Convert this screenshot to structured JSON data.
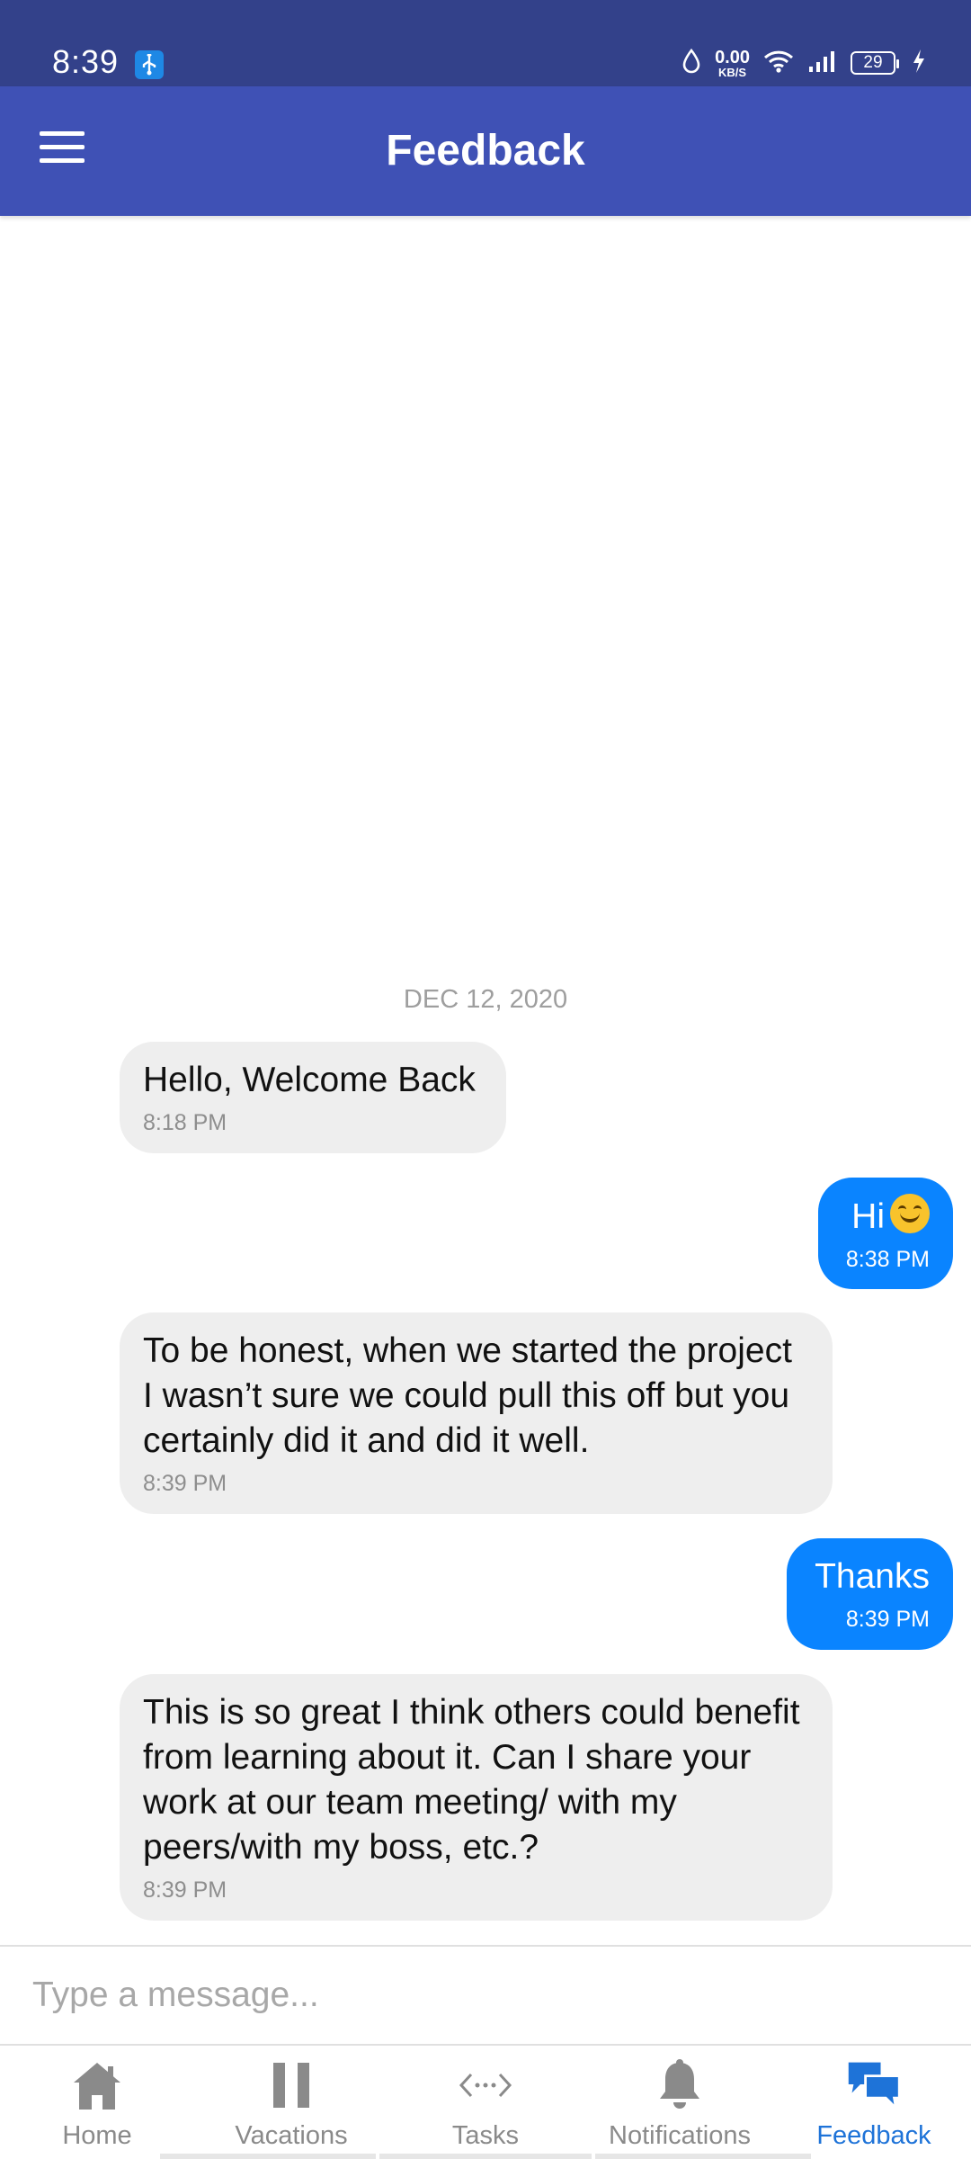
{
  "status_bar": {
    "time": "8:39",
    "net_speed_value": "0.00",
    "net_speed_unit": "KB/S",
    "battery_level": "29"
  },
  "app_bar": {
    "title": "Feedback"
  },
  "chat": {
    "date_separator": "DEC 12, 2020",
    "messages": [
      {
        "direction": "incoming",
        "text": "Hello, Welcome Back",
        "time": "8:18 PM"
      },
      {
        "direction": "outgoing",
        "text": "Hi",
        "emoji": "smiling-face",
        "time": "8:38 PM"
      },
      {
        "direction": "incoming",
        "text": "To be honest, when we started the project I wasn’t sure we could pull this off but you certainly did it and did it well.",
        "time": "8:39 PM"
      },
      {
        "direction": "outgoing",
        "text": "Thanks",
        "time": "8:39 PM"
      },
      {
        "direction": "incoming",
        "text": "This is so great I think others could benefit from learning about it. Can I share your work at our team meeting/ with my peers/with my boss, etc.?",
        "time": "8:39 PM"
      }
    ]
  },
  "composer": {
    "placeholder": "Type a message...",
    "value": ""
  },
  "bottom_nav": {
    "items": [
      {
        "label": "Home",
        "icon": "home-icon",
        "active": false
      },
      {
        "label": "Vacations",
        "icon": "pause-icon",
        "active": false
      },
      {
        "label": "Tasks",
        "icon": "code-arrows-icon",
        "active": false
      },
      {
        "label": "Notifications",
        "icon": "bell-icon",
        "active": false
      },
      {
        "label": "Feedback",
        "icon": "chat-bubbles-icon",
        "active": true
      }
    ]
  },
  "colors": {
    "status_bar": "#33418a",
    "app_bar": "#3f51b5",
    "outgoing_bubble": "#0a84ff",
    "incoming_bubble": "#eeeeee",
    "active_nav": "#1e73d8",
    "inactive_nav": "#8a8a8a"
  }
}
